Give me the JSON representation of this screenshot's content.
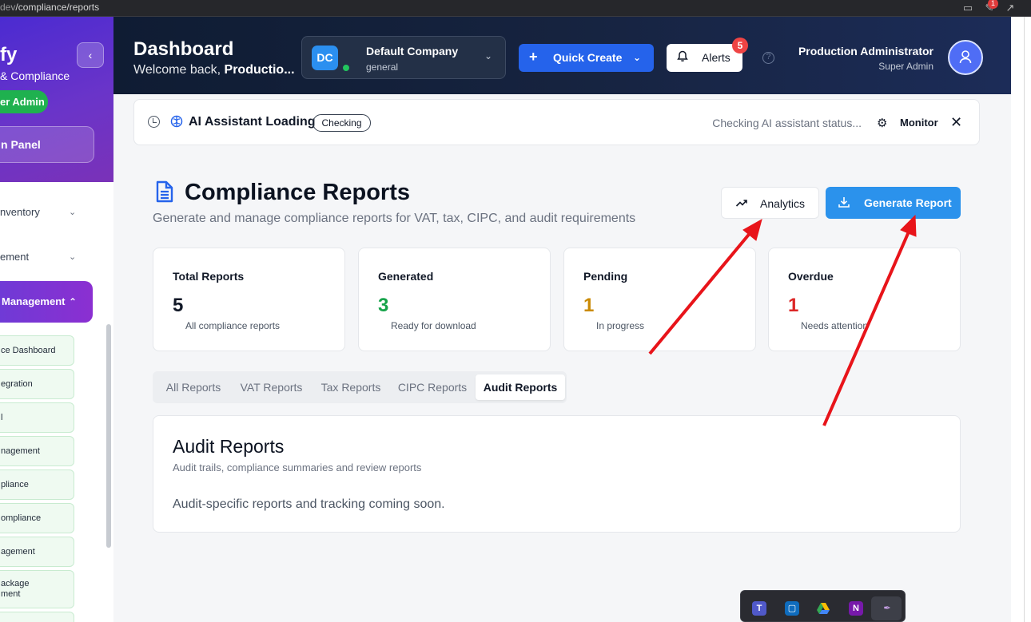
{
  "browser": {
    "url_host_fragment": "dev",
    "url_path": "/compliance/reports",
    "badge_count": "1"
  },
  "sidebar": {
    "brand": "fy",
    "subtitle": "& Compliance",
    "role_badge": "er Admin",
    "panel_button": "n Panel",
    "nav": [
      {
        "label": "nventory"
      },
      {
        "label": "ement"
      }
    ],
    "active_item": "Management",
    "sub_items": [
      "ce Dashboard",
      "egration",
      "l",
      "nagement",
      "pliance",
      "ompliance",
      "agement",
      "ackage\nment"
    ]
  },
  "header": {
    "title": "Dashboard",
    "welcome_prefix": "Welcome back, ",
    "welcome_name": "Productio...",
    "company": {
      "initials": "DC",
      "name": "Default Company",
      "plan": "general"
    },
    "quick_create_label": "Quick Create",
    "alerts_label": "Alerts",
    "alerts_count": "5",
    "help_glyph": "?",
    "user_name": "Production Administrator",
    "user_role": "Super Admin"
  },
  "ai_bar": {
    "title": "AI Assistant Loading",
    "chip": "Checking",
    "status": "Checking AI assistant status...",
    "monitor_label": "Monitor"
  },
  "page": {
    "title": "Compliance Reports",
    "subtitle": "Generate and manage compliance reports for VAT, tax, CIPC, and audit requirements",
    "analytics_label": "Analytics",
    "generate_label": "Generate Report"
  },
  "stats": [
    {
      "title": "Total Reports",
      "value": "5",
      "desc": "All compliance reports",
      "color": "#111827"
    },
    {
      "title": "Generated",
      "value": "3",
      "desc": "Ready for download",
      "color": "#16a34a"
    },
    {
      "title": "Pending",
      "value": "1",
      "desc": "In progress",
      "color": "#ca8a04"
    },
    {
      "title": "Overdue",
      "value": "1",
      "desc": "Needs attention",
      "color": "#dc2626"
    }
  ],
  "tabs": [
    {
      "label": "All Reports",
      "active": false
    },
    {
      "label": "VAT Reports",
      "active": false
    },
    {
      "label": "Tax Reports",
      "active": false
    },
    {
      "label": "CIPC Reports",
      "active": false
    },
    {
      "label": "Audit Reports",
      "active": true
    }
  ],
  "panel": {
    "title": "Audit Reports",
    "subtitle": "Audit trails, compliance summaries and review reports",
    "body": "Audit-specific reports and tracking coming soon."
  },
  "taskbar": {
    "apps": [
      "teams-icon",
      "outlook-icon",
      "drive-icon",
      "onenote-icon",
      "quill-icon"
    ]
  },
  "annotations": {
    "arrow_color": "#e8141a"
  }
}
